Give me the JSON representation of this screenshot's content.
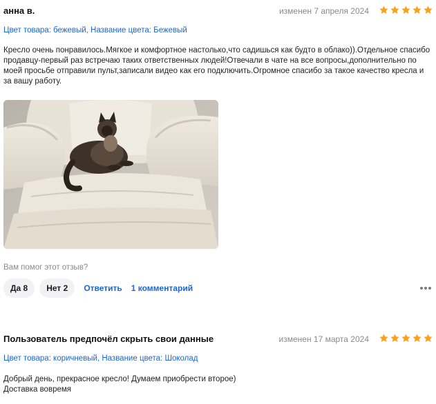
{
  "reviews": [
    {
      "author": "анна в.",
      "date": "изменен 7 апреля 2024",
      "rating": 5,
      "meta": "Цвет товара: бежевый, Название цвета: Бежевый",
      "text": "Кресло очень понравилось.Мягкое и комфортное настолько,что садишься как будто в облако)).Отдельное спасибо продавцу-первый раз встречаю таких ответственных людей!Отвечали в чате на все вопросы,дополнительно по моей просьбе отправили пульт,записали видео как его подключить.Огромное спасибо за такое качество кресла и за вашу работу.",
      "helpful_question": "Вам помог этот отзыв?",
      "yes_label": "Да 8",
      "no_label": "Нет 2",
      "reply_label": "Ответить",
      "comments_label": "1 комментарий"
    },
    {
      "author": "Пользователь предпочёл скрыть свои данные",
      "date": "изменен 17 марта 2024",
      "rating": 5,
      "meta": "Цвет товара: коричневый, Название цвета: Шоколад",
      "text_line1": "Добрый день, прекрасное кресло! Думаем приобрести второе)",
      "text_line2": "Доставка вовремя"
    }
  ],
  "colors": {
    "star": "#ff9f1a",
    "link": "#1a66d6",
    "muted": "#8a8a8a",
    "pill_bg": "#f2f2f4"
  }
}
